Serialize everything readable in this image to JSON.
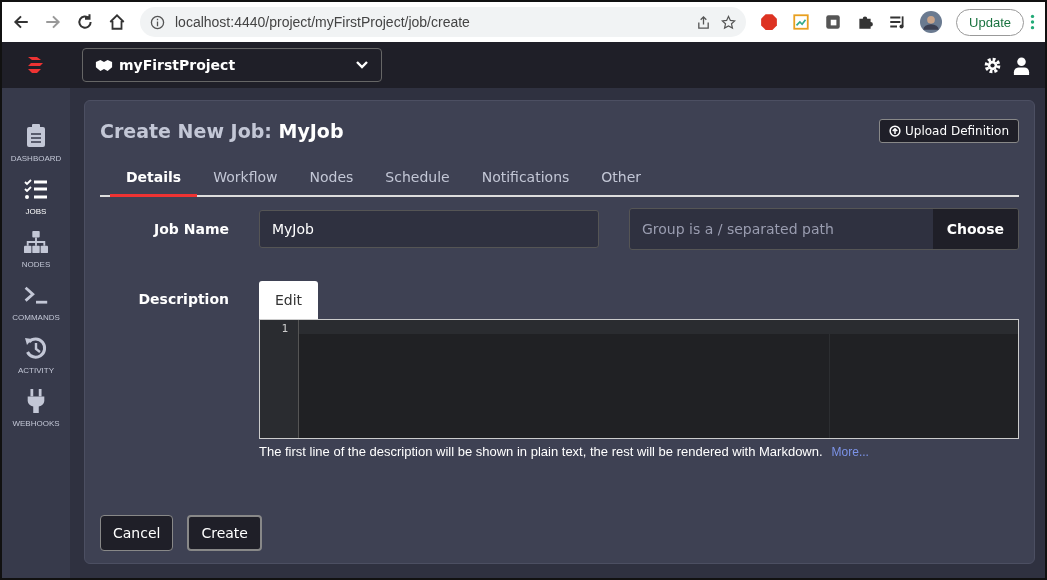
{
  "browser": {
    "url": "localhost:4440/project/myFirstProject/job/create",
    "update_button": "Update"
  },
  "header": {
    "project": "myFirstProject"
  },
  "sidebar": {
    "items": [
      {
        "label": "DASHBOARD",
        "kind": "clipboard",
        "selected": false
      },
      {
        "label": "JOBS",
        "kind": "checklist",
        "selected": true
      },
      {
        "label": "NODES",
        "kind": "tree",
        "selected": false
      },
      {
        "label": "COMMANDS",
        "kind": "terminal",
        "selected": false
      },
      {
        "label": "ACTIVITY",
        "kind": "history",
        "selected": false
      },
      {
        "label": "WEBHOOKS",
        "kind": "plug",
        "selected": false
      }
    ]
  },
  "page": {
    "title_prefix": "Create New Job:",
    "title_name": "MyJob",
    "upload_button": "Upload Definition",
    "tabs": [
      {
        "label": "Details",
        "selected": true
      },
      {
        "label": "Workflow",
        "selected": false
      },
      {
        "label": "Nodes",
        "selected": false
      },
      {
        "label": "Schedule",
        "selected": false
      },
      {
        "label": "Notifications",
        "selected": false
      },
      {
        "label": "Other",
        "selected": false
      }
    ],
    "job_name_label": "Job Name",
    "job_name_value": "MyJob",
    "group_placeholder": "Group is a / separated path",
    "choose_button": "Choose",
    "description_label": "Description",
    "editor_tab": "Edit",
    "line_numbers": [
      "1"
    ],
    "help_text": "The first line of the description will be shown in plain text, the rest will be rendered with Markdown.",
    "more_link": "More...",
    "buttons": [
      "Cancel",
      "Create"
    ]
  }
}
